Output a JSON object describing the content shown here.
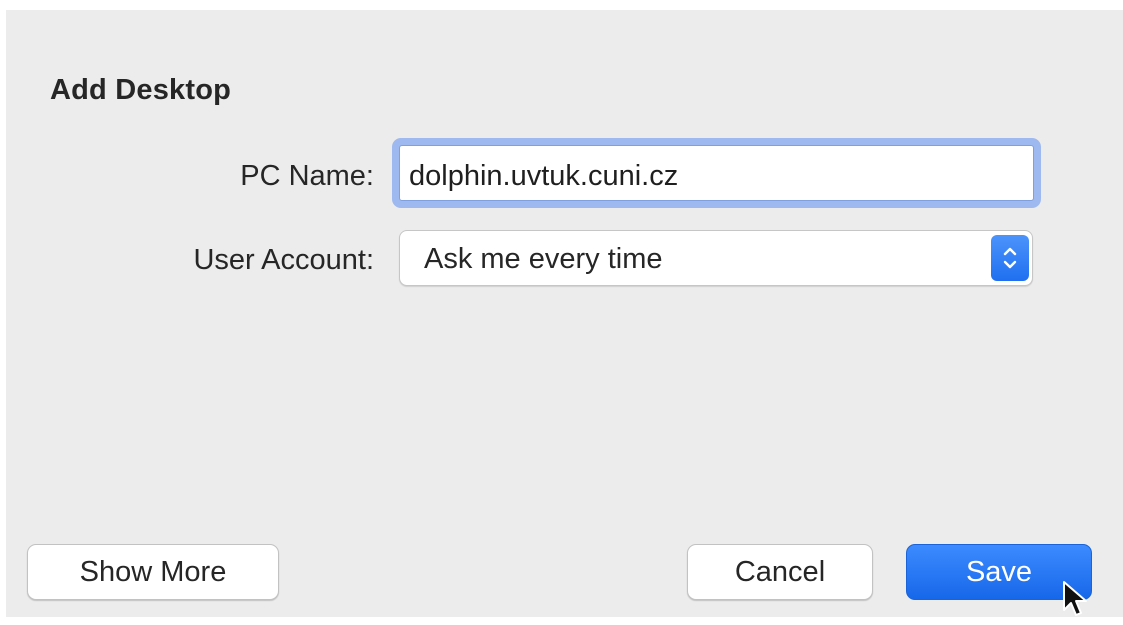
{
  "dialog": {
    "title": "Add Desktop",
    "pc_name": {
      "label": "PC Name:",
      "value": "dolphin.uvtuk.cuni.cz"
    },
    "user_account": {
      "label": "User Account:",
      "selected": "Ask me every time"
    }
  },
  "buttons": {
    "show_more": "Show More",
    "cancel": "Cancel",
    "save": "Save"
  },
  "colors": {
    "dialog_background": "#ececec",
    "accent": "#1f6ff0",
    "focus_ring": "#9db9ef"
  },
  "icons": {
    "select_arrows": "chevron-up-down-icon",
    "cursor": "mouse-pointer-icon"
  }
}
